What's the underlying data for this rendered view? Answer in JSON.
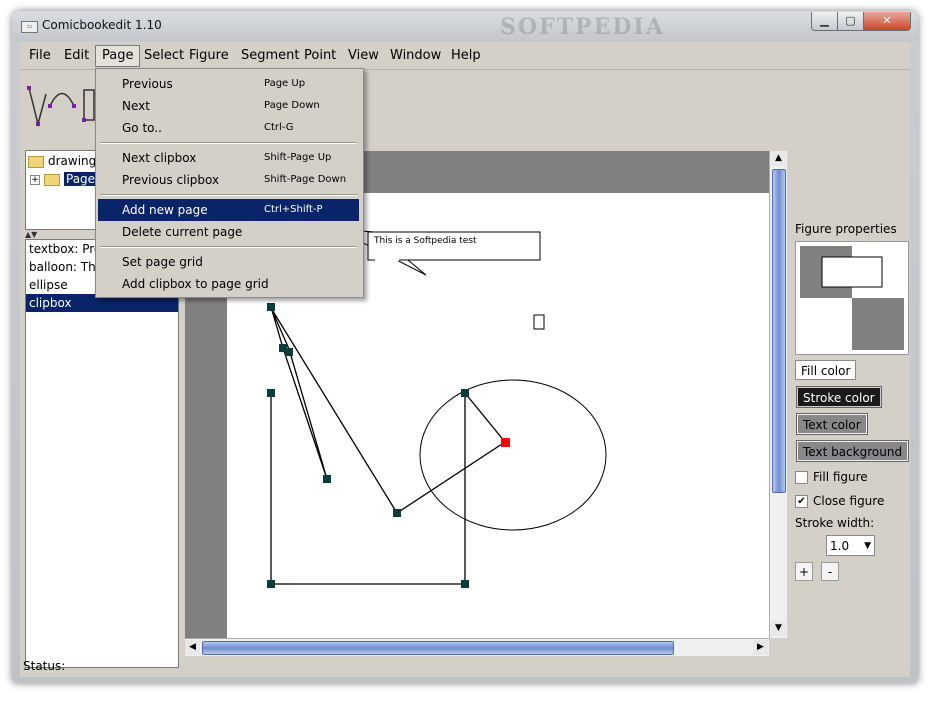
{
  "window": {
    "title": "Comicbookedit 1.10",
    "app_icon": "app-icon",
    "watermark": "SOFTPEDIA"
  },
  "menubar": [
    "File",
    "Edit",
    "Page",
    "Select",
    "Figure",
    "Segment",
    "Point",
    "View",
    "Window",
    "Help"
  ],
  "page_menu": {
    "items": [
      {
        "label": "Previous",
        "shortcut": "Page Up"
      },
      {
        "label": "Next",
        "shortcut": "Page Down"
      },
      {
        "label": "Go to..",
        "shortcut": "Ctrl-G"
      },
      {
        "label": "Next clipbox",
        "shortcut": "Shift-Page Up"
      },
      {
        "label": "Previous clipbox",
        "shortcut": "Shift-Page Down"
      },
      {
        "label": "Add new page",
        "shortcut": "Ctrl+Shift-P"
      },
      {
        "label": "Delete current page",
        "shortcut": ""
      },
      {
        "label": "Set page grid",
        "shortcut": ""
      },
      {
        "label": "Add clipbox to page grid",
        "shortcut": ""
      }
    ],
    "highlighted": "Add new page"
  },
  "tree": {
    "root": "drawing",
    "child": "Page"
  },
  "objects": [
    "textbox: Pres",
    "balloon: This",
    "ellipse",
    "clipbox"
  ],
  "selected_object": "clipbox",
  "canvas": {
    "balloon_text": "This is a Softpedia test"
  },
  "properties": {
    "title": "Figure properties",
    "fill_color": "Fill color",
    "stroke_color": "Stroke color",
    "text_color": "Text color",
    "text_background": "Text background",
    "fill_figure": {
      "label": "Fill figure",
      "checked": false
    },
    "close_figure": {
      "label": "Close figure",
      "checked": true
    },
    "stroke_width_label": "Stroke width:",
    "stroke_width": "1.0",
    "plus": "+",
    "minus": "-"
  },
  "status": "Status:",
  "colors": {
    "selection": "#0a246a",
    "accent_point": "#ff0000",
    "node": "#0b3d3d"
  }
}
